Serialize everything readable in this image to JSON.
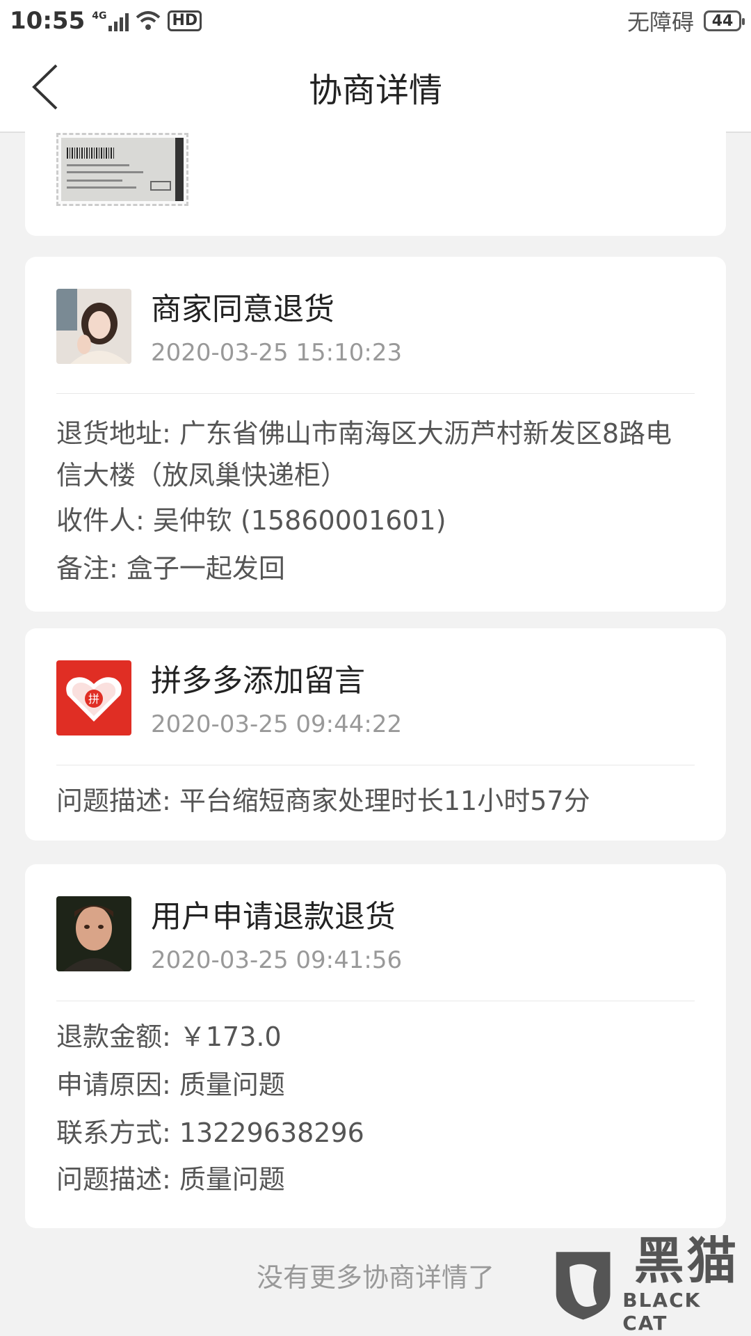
{
  "status_bar": {
    "time": "10:55",
    "network": "4G",
    "hd": "HD",
    "accessibility": "无障碍",
    "battery": "44"
  },
  "nav": {
    "title": "协商详情"
  },
  "entries": [
    {
      "title": "商家同意退货",
      "time": "2020-03-25 15:10:23",
      "details": [
        "退货地址: 广东省佛山市南海区大沥芦村新发区8路电信大楼（放凤巢快递柜）",
        "收件人: 吴仲钦 (15860001601)",
        "备注: 盒子一起发回"
      ]
    },
    {
      "title": "拼多多添加留言",
      "time": "2020-03-25 09:44:22",
      "details": [
        "问题描述: 平台缩短商家处理时长11小时57分"
      ]
    },
    {
      "title": "用户申请退款退货",
      "time": "2020-03-25 09:41:56",
      "details": [
        "退款金额: ￥173.0",
        "申请原因: 质量问题",
        "联系方式: 13229638296",
        "问题描述: 质量问题"
      ]
    }
  ],
  "footer": {
    "end_text": "没有更多协商详情了"
  },
  "watermark": {
    "cn": "黑猫",
    "en": "BLACK CAT"
  },
  "colors": {
    "pdd_red": "#e02e24",
    "time_gray": "#999999"
  }
}
